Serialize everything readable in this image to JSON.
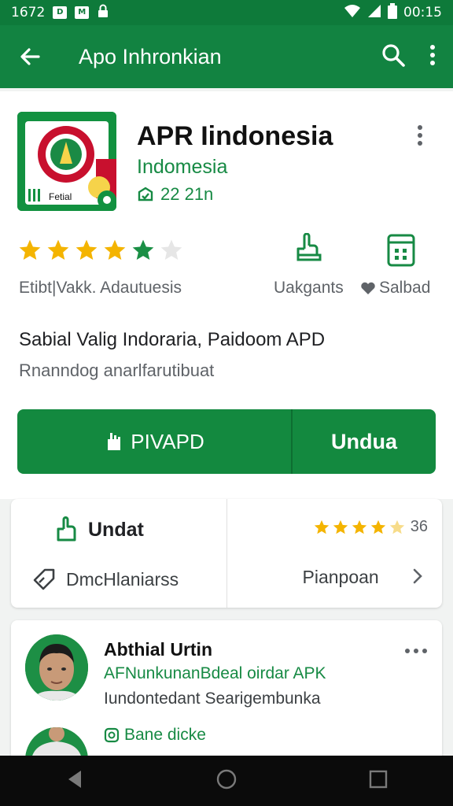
{
  "status_bar": {
    "left_text": "1672",
    "badge_1": "D",
    "badge_2": "M",
    "time": "00:15"
  },
  "app_bar": {
    "title": "Apo Inhronkian"
  },
  "app": {
    "name": "APR Iindonesia",
    "developer": "Indomesia",
    "meta": "22 21n",
    "icon_label": "Fetial"
  },
  "rating": {
    "stars_full": 5,
    "stars_total": 6,
    "label": "Etibt|Vakk.  Adautuesis"
  },
  "stats": {
    "a_label": "Uakgants",
    "b_label": "Salbad"
  },
  "description": {
    "line1": "Sabial Valig Indoraria, Paidoom APD",
    "line2": "Rnanndog anarlfarutibuat"
  },
  "buttons": {
    "primary": "PIVAPD",
    "secondary": "Undua"
  },
  "info_card": {
    "update_label": "Undat",
    "tag_label": "DmcHlaniarss",
    "rating_num": "36",
    "stars_full": 4,
    "pen_label": "Pianpoan"
  },
  "review": {
    "name": "Abthial Urtin",
    "line1": "AFNunkunanBdeal oirdar APK",
    "line2": "Iundontedant Searigembunka",
    "action": "Bane dicke"
  },
  "colors": {
    "brand": "#128341",
    "accent": "#13893f",
    "star": "#f4b400"
  }
}
